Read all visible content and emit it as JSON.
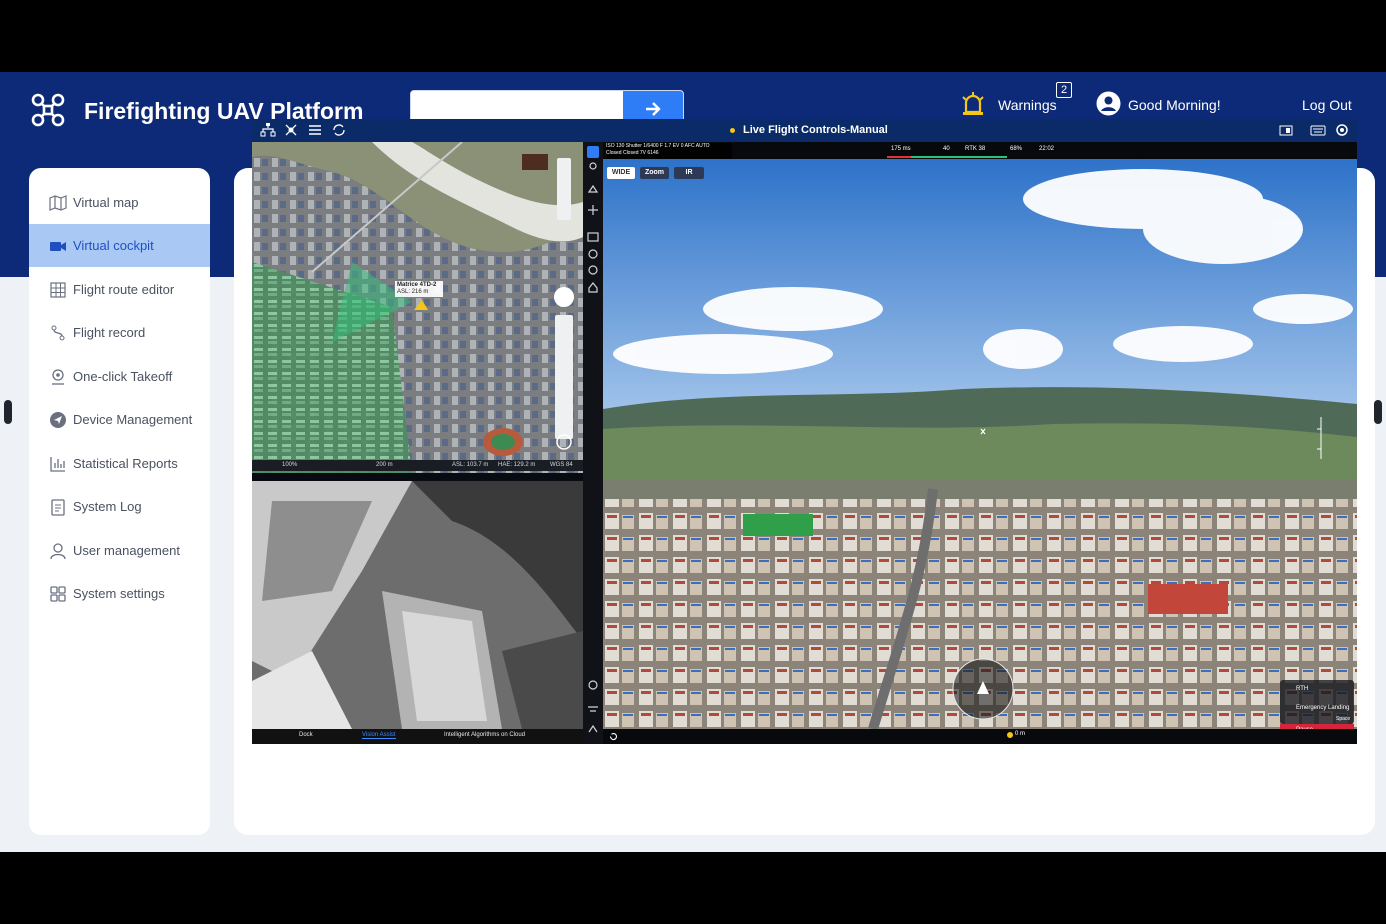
{
  "app": {
    "title": "Firefighting UAV Platform",
    "search_placeholder": "",
    "warnings_label": "Warnings",
    "warnings_count": "2",
    "greeting": "Good Morning!",
    "logout": "Log Out"
  },
  "sidebar": {
    "items": [
      {
        "label": "Virtual map",
        "icon": "map-icon"
      },
      {
        "label": "Virtual cockpit",
        "icon": "camera-icon",
        "active": true
      },
      {
        "label": "Flight route editor",
        "icon": "grid-icon"
      },
      {
        "label": "Flight record",
        "icon": "route-icon"
      },
      {
        "label": "One-click Takeoff",
        "icon": "location-pin-icon"
      },
      {
        "label": "Device Management",
        "icon": "send-icon"
      },
      {
        "label": "Statistical Reports",
        "icon": "bar-chart-icon"
      },
      {
        "label": "System Log",
        "icon": "document-icon"
      },
      {
        "label": "User management",
        "icon": "user-icon"
      },
      {
        "label": "System settings",
        "icon": "apps-icon"
      }
    ]
  },
  "cockpit": {
    "title": "Live Flight Controls-Manual",
    "map": {
      "aircraft": "Matrice 4TD-2",
      "aircraft_sub": "ASL: 216 m",
      "status": {
        "zoom": "100%",
        "scale": "200 m",
        "asl": "ASL: 103.7 m",
        "hae": "HAE: 129.2 m",
        "datum": "WGS 84"
      }
    },
    "ir_tabs": [
      "Dock",
      "Vision Assist",
      "Intelligent Algorithms on Cloud"
    ],
    "camera": {
      "line1": "ISO 130  Shutter 1/6400  F 1.7  EV 0  AFC  AUTO",
      "line2": "Closed   Closed   7V 6146",
      "lenses": [
        "WIDE",
        "Zoom",
        "IR"
      ]
    },
    "telemetry": {
      "latency": "175 ms",
      "signal": "40",
      "rtk": "RTK 38",
      "battery": "68%",
      "time": "22:02"
    },
    "controls": {
      "rtk": "RTH",
      "emergency": "Emergency Landing",
      "space": "Space",
      "pause": "Pause"
    },
    "bottom": {
      "distance": "0 m"
    }
  },
  "colors": {
    "header": "#0c2a77",
    "accent": "#2f7df6",
    "active_nav": "#a9c9f4",
    "warning": "#f5c518"
  }
}
